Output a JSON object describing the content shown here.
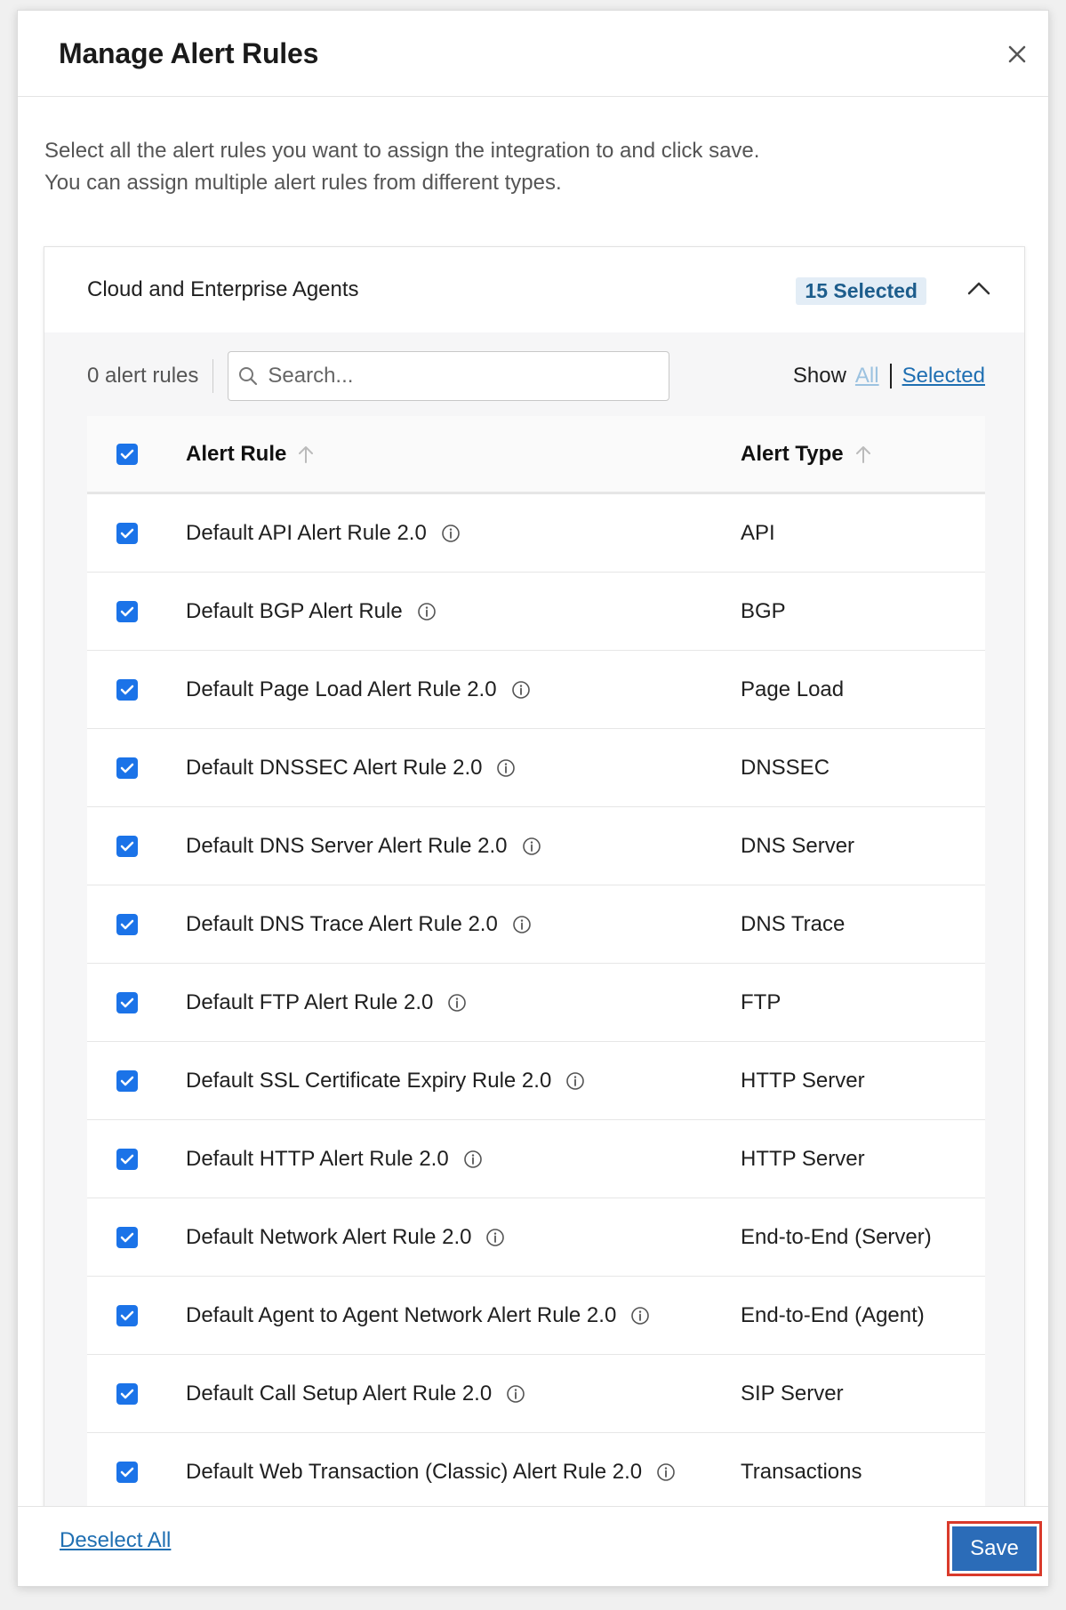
{
  "modal": {
    "title": "Manage Alert Rules",
    "intro_line1": "Select all the alert rules you want to assign the integration to and click save.",
    "intro_line2": "You can assign multiple alert rules from different types."
  },
  "section": {
    "title": "Cloud and Enterprise Agents",
    "selected_badge": "15 Selected",
    "expanded": true
  },
  "toolbar": {
    "rule_count": "0 alert rules",
    "search_placeholder": "Search...",
    "search_value": "",
    "show_label": "Show",
    "show_all": "All",
    "show_selected": "Selected"
  },
  "table": {
    "col_rule": "Alert Rule",
    "col_type": "Alert Type",
    "rows": [
      {
        "name": "Default API Alert Rule 2.0",
        "type": "API",
        "checked": true
      },
      {
        "name": "Default BGP Alert Rule",
        "type": "BGP",
        "checked": true
      },
      {
        "name": "Default Page Load Alert Rule 2.0",
        "type": "Page Load",
        "checked": true
      },
      {
        "name": "Default DNSSEC Alert Rule 2.0",
        "type": "DNSSEC",
        "checked": true
      },
      {
        "name": "Default DNS Server Alert Rule 2.0",
        "type": "DNS Server",
        "checked": true
      },
      {
        "name": "Default DNS Trace Alert Rule 2.0",
        "type": "DNS Trace",
        "checked": true
      },
      {
        "name": "Default FTP Alert Rule 2.0",
        "type": "FTP",
        "checked": true
      },
      {
        "name": "Default SSL Certificate Expiry Rule 2.0",
        "type": "HTTP Server",
        "checked": true
      },
      {
        "name": "Default HTTP Alert Rule 2.0",
        "type": "HTTP Server",
        "checked": true
      },
      {
        "name": "Default Network Alert Rule 2.0",
        "type": "End-to-End (Server)",
        "checked": true
      },
      {
        "name": "Default Agent to Agent Network Alert Rule 2.0",
        "type": "End-to-End (Agent)",
        "checked": true
      },
      {
        "name": "Default Call Setup Alert Rule 2.0",
        "type": "SIP Server",
        "checked": true
      },
      {
        "name": "Default Web Transaction (Classic) Alert Rule 2.0",
        "type": "Transactions",
        "checked": true
      }
    ]
  },
  "footer": {
    "deselect_all": "Deselect All",
    "save": "Save"
  },
  "colors": {
    "checkbox": "#1b73e8",
    "link": "#1f6fb2",
    "save_button": "#2b6cb8",
    "save_highlight": "#d93a2b",
    "badge_bg": "#e3edf6"
  }
}
